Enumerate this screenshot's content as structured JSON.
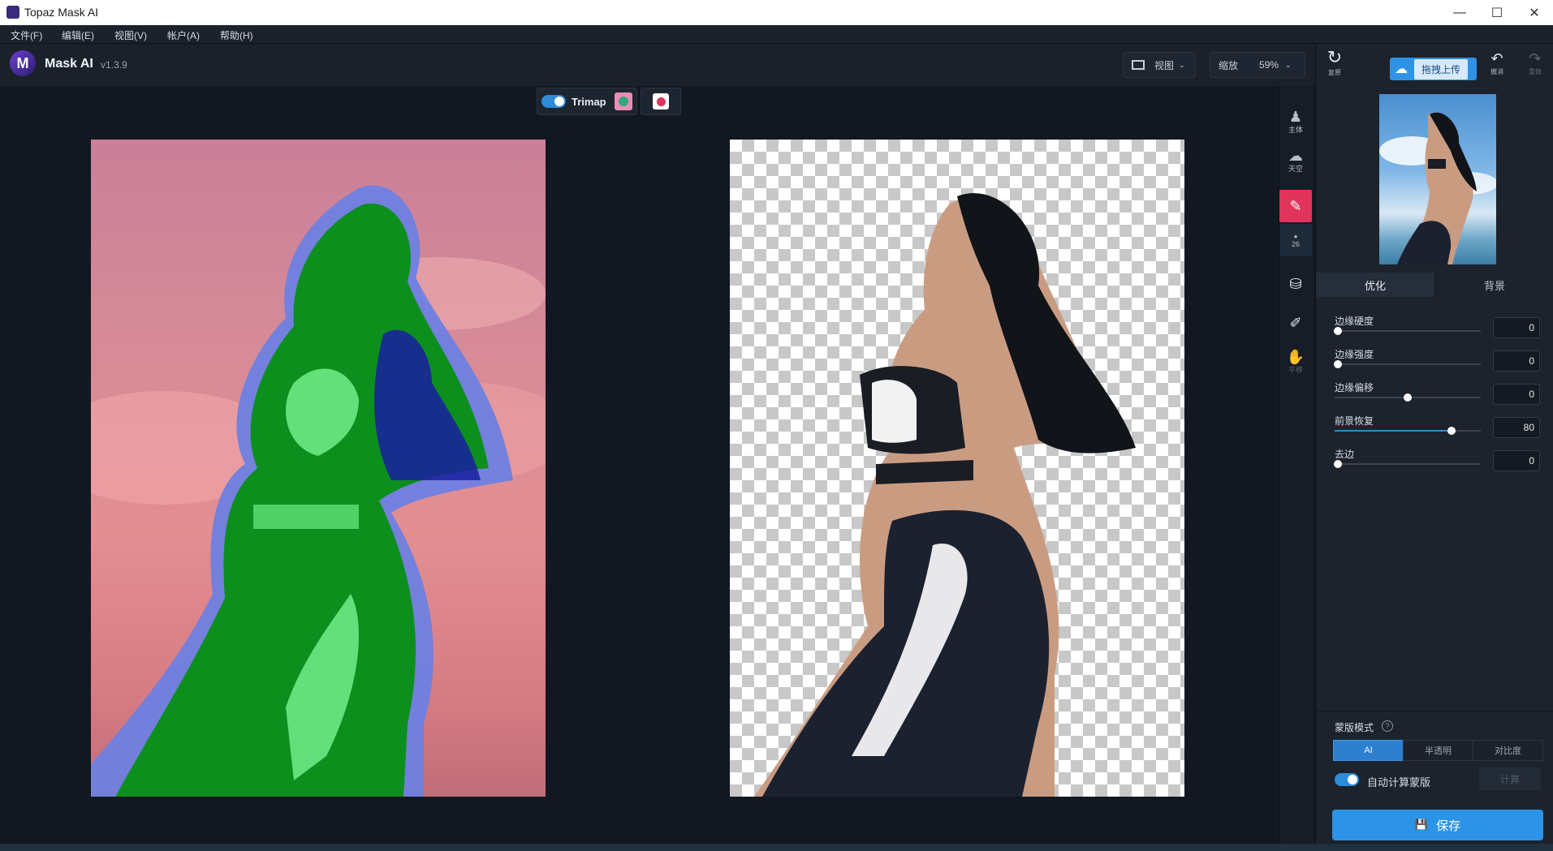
{
  "window": {
    "title": "Topaz Mask AI",
    "minimize": "—",
    "maximize": "☐",
    "close": "✕"
  },
  "menu": [
    "文件(F)",
    "编辑(E)",
    "视图(V)",
    "帐户(A)",
    "帮助(H)"
  ],
  "header": {
    "brand": "Mask AI",
    "version": "v1.3.9",
    "view_label": "视图",
    "zoom_label": "缩放",
    "zoom_value": "59%"
  },
  "toolbar_right": {
    "reset_label": "复原",
    "upload_label": "拖拽上传",
    "undo_label": "撤消",
    "redo_label": "重做"
  },
  "canvas": {
    "trimap_label": "Trimap"
  },
  "tools": [
    {
      "icon": "person-icon",
      "label": "主体"
    },
    {
      "icon": "cloud-icon",
      "label": "天空"
    },
    {
      "icon": "erase-brush-icon",
      "label": ""
    },
    {
      "icon": "brush-size-icon",
      "label": "26"
    },
    {
      "icon": "fill-bucket-icon",
      "label": ""
    },
    {
      "icon": "eyedropper-icon",
      "label": ""
    },
    {
      "icon": "hand-icon",
      "label": "平移"
    }
  ],
  "panel": {
    "tabs": [
      "优化",
      "背景"
    ],
    "sliders": [
      {
        "label": "边缘硬度",
        "value": "0",
        "level": 0.02
      },
      {
        "label": "边缘强度",
        "value": "0",
        "level": 0.02
      },
      {
        "label": "边缘偏移",
        "value": "0",
        "level": 0.5
      },
      {
        "label": "前景恢复",
        "value": "80",
        "level": 0.8
      },
      {
        "label": "去边",
        "value": "0",
        "level": 0.02
      }
    ],
    "mask_mode_label": "蒙版模式",
    "mask_modes": [
      "AI",
      "半透明",
      "对比度"
    ],
    "auto_compute_label": "自动计算蒙版",
    "compute_label": "计算",
    "save_label": "保存"
  },
  "colors": {
    "accent": "#2d93e6",
    "active_tool": "#e0345a",
    "panel_bg": "#1c232d"
  }
}
